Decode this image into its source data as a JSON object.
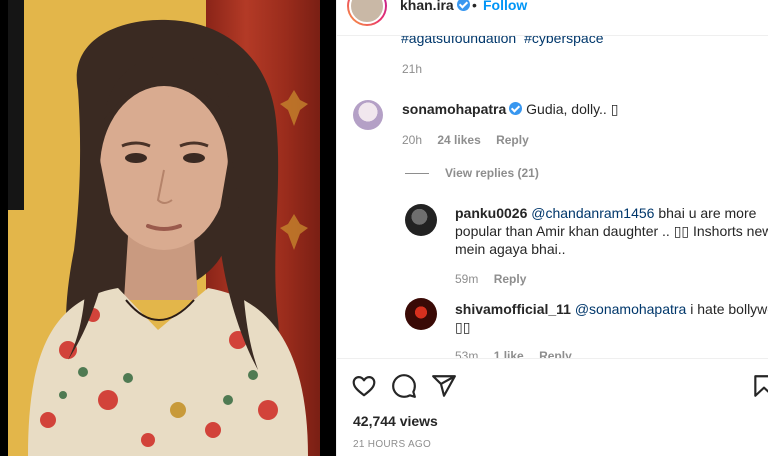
{
  "post": {
    "username": "khan.ira",
    "separator": "•",
    "follow_label": "Follow",
    "hashtags": [
      "#agatsufoundation",
      "#cyberspace"
    ],
    "caption_time": "21h"
  },
  "comments": [
    {
      "username": "sonamohapatra",
      "verified": true,
      "text": "Gudia, dolly.. ",
      "emoji": "▯",
      "time": "20h",
      "likes": "24 likes",
      "reply_label": "Reply",
      "view_replies": "View replies (21)"
    }
  ],
  "replies": [
    {
      "username": "panku0026",
      "mention": "@chandanram1456",
      "text_line1": " bhai u are more",
      "text_line2": "popular than Amir khan daughter .. ▯▯ Inshorts news",
      "text_line3": "mein agaya bhai..",
      "time": "59m",
      "reply_label": "Reply"
    },
    {
      "username": "shivamofficial_11",
      "mention": "@sonamohapatra",
      "text_line1": " i hate bollywood",
      "text_line2": "▯▯",
      "time": "53m",
      "likes": "1 like",
      "reply_label": "Reply"
    }
  ],
  "footer": {
    "views": "42,744 views",
    "posted": "21 HOURS AGO"
  },
  "icons": {
    "like": "heart-icon",
    "comment": "comment-icon",
    "share": "share-icon",
    "save": "bookmark-icon"
  },
  "colors": {
    "link": "#00376b",
    "follow": "#0095f6",
    "muted": "#8e8e8e",
    "verified": "#3897f0"
  }
}
